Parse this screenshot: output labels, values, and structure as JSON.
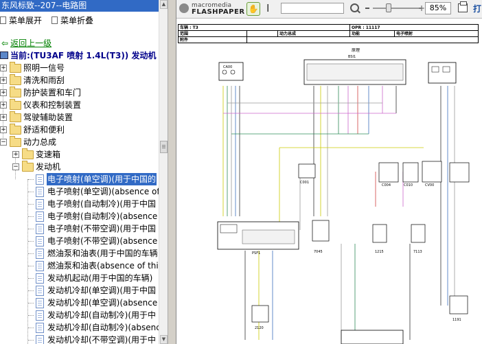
{
  "window": {
    "title": "东风标致--207--电路图"
  },
  "left_toolbar": {
    "expand_label": "菜单展开",
    "collapse_label": "菜单折叠"
  },
  "nav": {
    "back_label": "返回上一级",
    "current_label": "当前:(TU3AF 喷射  1.4L(T3)) 发动机"
  },
  "tree": {
    "folders": [
      {
        "label": "照明一信号"
      },
      {
        "label": "清洗和雨刮"
      },
      {
        "label": "防护装置和车门"
      },
      {
        "label": "仪表和控制装置"
      },
      {
        "label": "驾驶辅助装置"
      },
      {
        "label": "舒适和便利"
      },
      {
        "label": "动力总成"
      },
      {
        "label": "变速箱"
      },
      {
        "label": "发动机"
      }
    ],
    "docs": [
      {
        "label": "电子喷射(单空调)(用于中国的"
      },
      {
        "label": "电子喷射(单空调)(absence of"
      },
      {
        "label": "电子喷射(自动制冷)(用于中国"
      },
      {
        "label": "电子喷射(自动制冷)(absence"
      },
      {
        "label": "电子喷射(不带空调)(用于中国"
      },
      {
        "label": "电子喷射(不带空调)(absence"
      },
      {
        "label": "燃油泵和油表(用于中国的车辆"
      },
      {
        "label": "燃油泵和油表(absence of thi"
      },
      {
        "label": "发动机起动(用于中国的车辆)"
      },
      {
        "label": "发动机冷却(单空调)(用于中国"
      },
      {
        "label": "发动机冷却(单空调)(absence"
      },
      {
        "label": "发动机冷却(自动制冷)(用于中"
      },
      {
        "label": "发动机冷却(自动制冷)(absenc"
      },
      {
        "label": "发动机冷却(不带空调)(用于中"
      }
    ]
  },
  "viewer": {
    "brand": "macromedia",
    "product": "FLASHPAPER",
    "zoom": "85%",
    "print_label": "打"
  },
  "document": {
    "header": {
      "vehicle_label": "车辆 : T3",
      "opr_label": "OPR : 11117",
      "scope_label": "范围",
      "powertrain_label": "动力总成",
      "function_label": "功能",
      "function_value": "电子喷射",
      "accessory_label": "附件"
    },
    "diagram_title": "原理",
    "components": [
      "BSI1",
      "CA00",
      "C001",
      "C004",
      "C010",
      "CV00",
      "PSF1",
      "7045",
      "1215",
      "7113",
      "2120",
      "1191"
    ]
  },
  "colors": {
    "selection": "#316ac5",
    "title_bar": "#316ac5"
  }
}
